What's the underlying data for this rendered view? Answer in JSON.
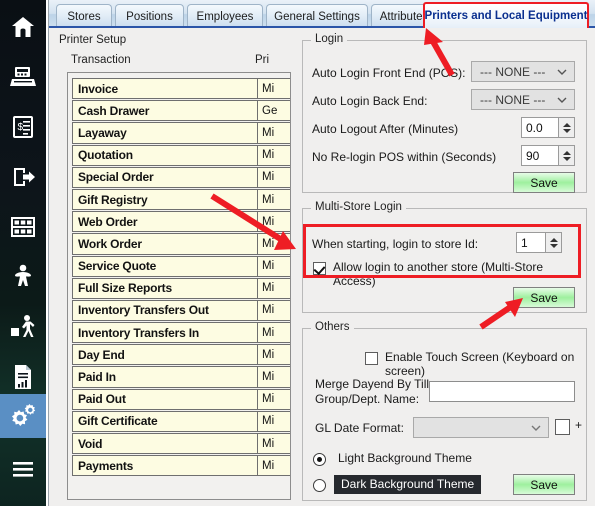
{
  "sidebar": {
    "items": [
      {
        "name": "home-icon",
        "label": "Home"
      },
      {
        "name": "cash-register-icon",
        "label": "POS"
      },
      {
        "name": "invoice-icon",
        "label": "Invoice"
      },
      {
        "name": "logout-icon",
        "label": "Logout"
      },
      {
        "name": "inventory-icon",
        "label": "Inventory"
      },
      {
        "name": "customer-icon",
        "label": "Customer"
      },
      {
        "name": "employee-icon",
        "label": "Employee"
      },
      {
        "name": "report-icon",
        "label": "Reports"
      },
      {
        "name": "settings-gears-icon",
        "label": "Settings"
      },
      {
        "name": "hamburger-menu-icon",
        "label": "Menu"
      }
    ],
    "active_index": 8
  },
  "tabs": [
    {
      "label": "Stores",
      "active": false
    },
    {
      "label": "Positions",
      "active": false
    },
    {
      "label": "Employees",
      "active": false
    },
    {
      "label": "General Settings",
      "active": false
    },
    {
      "label": "Attributes",
      "active": false
    },
    {
      "label": "Printers and Local Equipment",
      "active": true
    }
  ],
  "printer_setup": {
    "title": "Printer Setup",
    "col_transaction": "Transaction",
    "col_printer": "Pri",
    "rows": [
      {
        "transaction": "Invoice",
        "printer": "Mi"
      },
      {
        "transaction": "Cash Drawer",
        "printer": "Ge"
      },
      {
        "transaction": "Layaway",
        "printer": "Mi"
      },
      {
        "transaction": "Quotation",
        "printer": "Mi"
      },
      {
        "transaction": "Special Order",
        "printer": "Mi"
      },
      {
        "transaction": "Gift Registry",
        "printer": "Mi"
      },
      {
        "transaction": "Web Order",
        "printer": "Mi"
      },
      {
        "transaction": "Work Order",
        "printer": "Mi"
      },
      {
        "transaction": "Service Quote",
        "printer": "Mi"
      },
      {
        "transaction": "Full Size Reports",
        "printer": "Mi"
      },
      {
        "transaction": "Inventory Transfers Out",
        "printer": "Mi"
      },
      {
        "transaction": "Inventory Transfers In",
        "printer": "Mi"
      },
      {
        "transaction": "Day End",
        "printer": "Mi"
      },
      {
        "transaction": "Paid In",
        "printer": "Mi"
      },
      {
        "transaction": "Paid Out",
        "printer": "Mi"
      },
      {
        "transaction": "Gift Certificate",
        "printer": "Mi"
      },
      {
        "transaction": "Void",
        "printer": "Mi"
      },
      {
        "transaction": "Payments",
        "printer": "Mi"
      }
    ]
  },
  "login": {
    "group_label": "Login",
    "front_end_label": "Auto Login Front End (POS):",
    "front_end_value": "--- NONE ---",
    "back_end_label": "Auto Login Back End:",
    "back_end_value": "--- NONE ---",
    "auto_logout_label": "Auto Logout After (Minutes)",
    "auto_logout_value": "0.0",
    "no_relogin_label": "No Re-login POS within (Seconds)",
    "no_relogin_value": "90",
    "save_label": "Save"
  },
  "multi_store": {
    "group_label": "Multi-Store Login",
    "store_id_label": "When starting, login to store Id:",
    "store_id_value": "1",
    "allow_login_label": "Allow login to another store (Multi-Store Access)",
    "allow_login_checked": true,
    "save_label": "Save"
  },
  "others": {
    "group_label": "Others",
    "touch_screen_label": "Enable Touch Screen (Keyboard on screen)",
    "touch_screen_checked": false,
    "merge_dayend_label_line1": "Merge Dayend By Till",
    "merge_dayend_label_line2": "Group/Dept. Name:",
    "merge_dayend_value": "",
    "gl_date_label": "GL Date Format:",
    "gl_date_value": "",
    "plus_label": "+",
    "plus_checked": false,
    "light_theme_label": "Light Background Theme",
    "dark_theme_label": "Dark Background Theme",
    "theme_selected": "light",
    "save_label": "Save"
  },
  "annotations": {
    "accent_color": "#ee1d24",
    "arrow_count": 3,
    "highlight_boxes": 2
  }
}
